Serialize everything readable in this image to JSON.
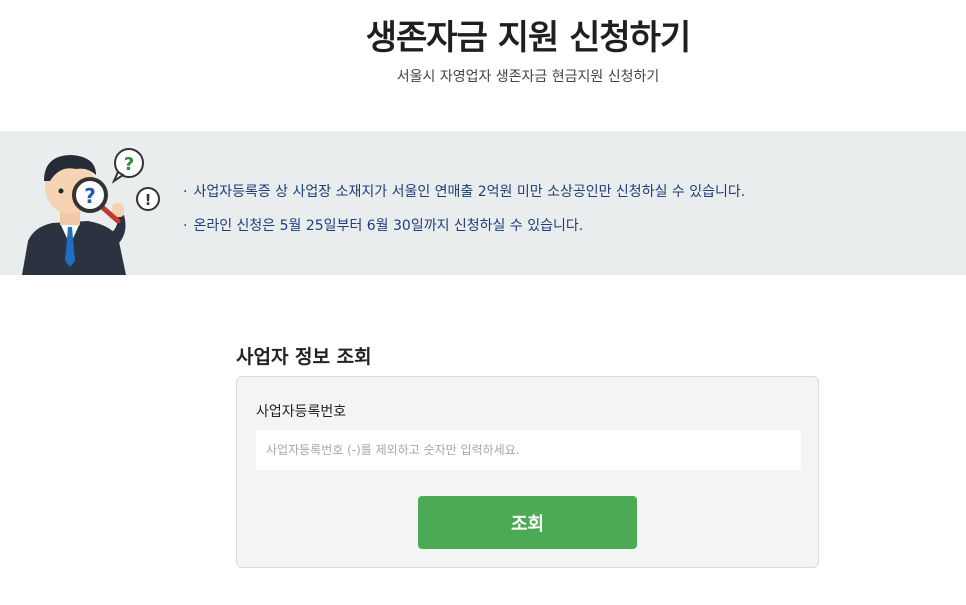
{
  "header": {
    "title": "생존자금 지원 신청하기",
    "subtitle": "서울시 자영업자 생존자금 현금지원 신청하기"
  },
  "notice": {
    "bullet": "·",
    "items": [
      "사업자등록증 상 사업장 소재지가 서울인 연매출 2억원 미만 소상공인만 신청하실 수 있습니다.",
      "온라인 신청은 5월 25일부터 6월 30일까지 신청하실 수 있습니다."
    ],
    "colors": {
      "background": "#e9eded",
      "text": "#1f3d7a"
    },
    "icons": [
      "mascot-illustration",
      "question-mark-icon",
      "exclamation-mark-icon",
      "magnifying-glass-icon"
    ]
  },
  "lookup": {
    "section_title": "사업자 정보 조회",
    "field_label": "사업자등록번호",
    "input_value": "",
    "input_placeholder": "사업자등록번호 (-)를 제외하고 숫자만 입력하세요.",
    "button_label": "조회",
    "colors": {
      "button": "#4caa55",
      "card": "#f3f4f4"
    }
  }
}
